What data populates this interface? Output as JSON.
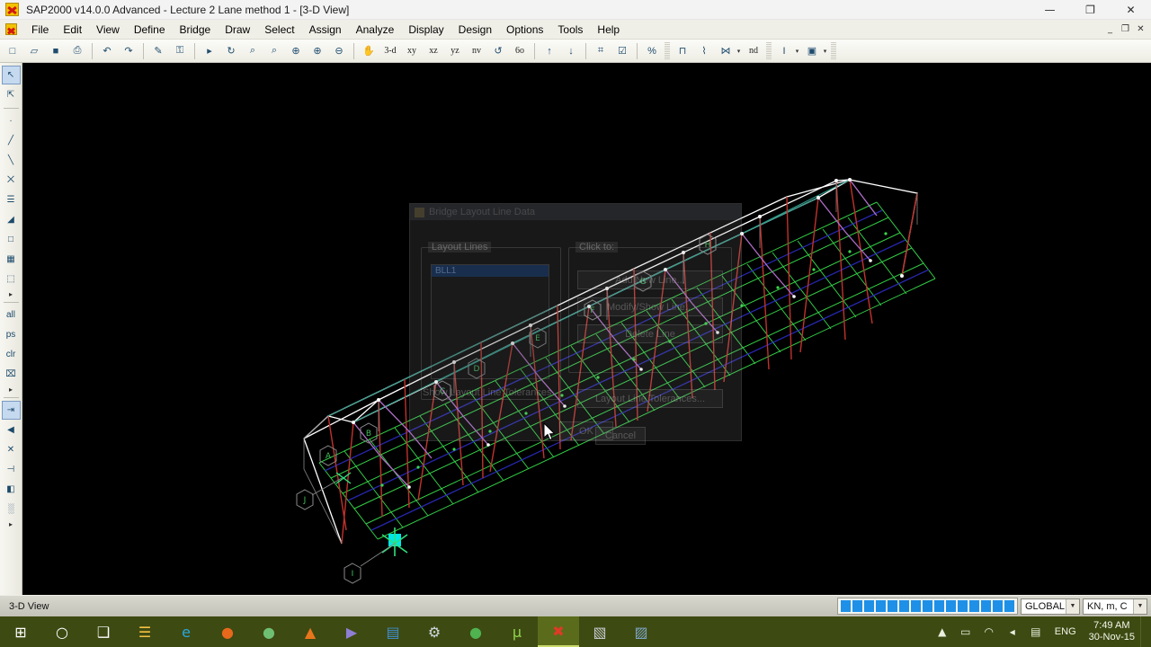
{
  "window": {
    "title": "SAP2000 v14.0.0 Advanced  - Lecture 2 Lane method 1 - [3-D View]",
    "app_icon": "sap2000-icon",
    "minimize": "—",
    "maximize": "❐",
    "close": "✕"
  },
  "mdi": {
    "minimize": "_",
    "restore": "❐",
    "close": "✕"
  },
  "menu": {
    "items": [
      {
        "label": "File"
      },
      {
        "label": "Edit"
      },
      {
        "label": "View"
      },
      {
        "label": "Define"
      },
      {
        "label": "Bridge"
      },
      {
        "label": "Draw"
      },
      {
        "label": "Select"
      },
      {
        "label": "Assign"
      },
      {
        "label": "Analyze"
      },
      {
        "label": "Display"
      },
      {
        "label": "Design"
      },
      {
        "label": "Options"
      },
      {
        "label": "Tools"
      },
      {
        "label": "Help"
      }
    ]
  },
  "toolbar": {
    "items": [
      {
        "name": "new-file-icon",
        "glyph": "□",
        "type": "icon"
      },
      {
        "name": "open-file-icon",
        "glyph": "▱",
        "type": "icon"
      },
      {
        "name": "save-icon",
        "glyph": "■",
        "type": "icon"
      },
      {
        "name": "print-icon",
        "glyph": "⎙",
        "type": "icon"
      },
      {
        "name": "sep1",
        "glyph": "",
        "type": "sep"
      },
      {
        "name": "undo-icon",
        "glyph": "↶",
        "type": "icon"
      },
      {
        "name": "redo-icon",
        "glyph": "↷",
        "type": "icon"
      },
      {
        "name": "sep2",
        "glyph": "",
        "type": "sep"
      },
      {
        "name": "refresh-window-icon",
        "glyph": "✎",
        "type": "icon"
      },
      {
        "name": "lock-unlock-model-icon",
        "glyph": "⚿",
        "type": "icon"
      },
      {
        "name": "sep3",
        "glyph": "",
        "type": "sep"
      },
      {
        "name": "run-analysis-icon",
        "glyph": "▸",
        "type": "icon"
      },
      {
        "name": "rubber-band-zoom-icon",
        "glyph": "↻",
        "type": "icon"
      },
      {
        "name": "restore-full-view-icon",
        "glyph": "⌕",
        "type": "icon"
      },
      {
        "name": "previous-zoom-icon",
        "glyph": "⌕",
        "type": "icon"
      },
      {
        "name": "zoom-in-one-step-icon",
        "glyph": "⊕",
        "type": "icon"
      },
      {
        "name": "zoom-in-icon",
        "glyph": "⊕",
        "type": "icon"
      },
      {
        "name": "zoom-out-icon",
        "glyph": "⊖",
        "type": "icon"
      },
      {
        "name": "sep4",
        "glyph": "",
        "type": "sep"
      },
      {
        "name": "pan-icon",
        "glyph": "✋",
        "type": "icon"
      },
      {
        "name": "view-3d-label",
        "glyph": "3-d",
        "type": "text"
      },
      {
        "name": "view-xy-label",
        "glyph": "xy",
        "type": "text"
      },
      {
        "name": "view-xz-label",
        "glyph": "xz",
        "type": "text"
      },
      {
        "name": "view-yz-label",
        "glyph": "yz",
        "type": "text"
      },
      {
        "name": "view-nv-label",
        "glyph": "nv",
        "type": "text"
      },
      {
        "name": "rotate-3d-view-icon",
        "glyph": "↺",
        "type": "icon"
      },
      {
        "name": "perspective-toggle-label",
        "glyph": "6o",
        "type": "text"
      },
      {
        "name": "sep5",
        "glyph": "",
        "type": "sep"
      },
      {
        "name": "move-up-in-list-icon",
        "glyph": "↑",
        "type": "icon"
      },
      {
        "name": "move-down-in-list-icon",
        "glyph": "↓",
        "type": "icon"
      },
      {
        "name": "sep6",
        "glyph": "",
        "type": "sep"
      },
      {
        "name": "set-display-options-icon",
        "glyph": "⌗",
        "type": "icon"
      },
      {
        "name": "set-select-mode-icon",
        "glyph": "☑",
        "type": "icon"
      },
      {
        "name": "sep7",
        "glyph": "",
        "type": "sep"
      },
      {
        "name": "scale-percent-icon",
        "glyph": "%",
        "type": "icon"
      },
      {
        "name": "grip1",
        "glyph": "",
        "type": "grip"
      },
      {
        "name": "draw-frame-icon",
        "glyph": "⊓",
        "type": "icon"
      },
      {
        "name": "draw-secondary-icon",
        "glyph": "⌇",
        "type": "icon"
      },
      {
        "name": "draw-section-cut-icon",
        "glyph": "⋈",
        "type": "icon"
      },
      {
        "name": "drop-section",
        "glyph": "▾",
        "type": "drop"
      },
      {
        "name": "no-design-label",
        "glyph": "nd",
        "type": "text"
      },
      {
        "name": "grip2",
        "glyph": "",
        "type": "grip"
      },
      {
        "name": "text-tool-icon",
        "glyph": "I",
        "type": "icon"
      },
      {
        "name": "drop-text",
        "glyph": "▾",
        "type": "drop"
      },
      {
        "name": "snap-picture-icon",
        "glyph": "▣",
        "type": "icon"
      },
      {
        "name": "drop-picture",
        "glyph": "▾",
        "type": "drop"
      },
      {
        "name": "grip3",
        "glyph": "",
        "type": "grip"
      }
    ]
  },
  "left_toolbar": {
    "items": [
      {
        "name": "pointer-select-icon",
        "glyph": "↖",
        "selected": true
      },
      {
        "name": "reshape-element-icon",
        "glyph": "⇱",
        "selected": false
      },
      {
        "name": "sep-a",
        "glyph": "",
        "type": "sep"
      },
      {
        "name": "draw-point-icon",
        "glyph": "·",
        "selected": false
      },
      {
        "name": "draw-frame-cable-icon",
        "glyph": "╱",
        "selected": false
      },
      {
        "name": "quick-draw-frame-icon",
        "glyph": "╲",
        "selected": false
      },
      {
        "name": "quick-draw-brace-icon",
        "glyph": "⨉",
        "selected": false
      },
      {
        "name": "quick-draw-secondary-icon",
        "glyph": "☰",
        "selected": false
      },
      {
        "name": "draw-poly-area-icon",
        "glyph": "◢",
        "selected": false
      },
      {
        "name": "draw-rectangular-area-icon",
        "glyph": "□",
        "selected": false
      },
      {
        "name": "quick-draw-area-icon",
        "glyph": "▦",
        "selected": false
      },
      {
        "name": "draw-solid-icon",
        "glyph": "⬚",
        "selected": false
      },
      {
        "name": "draw-more-icon",
        "glyph": "▸",
        "type": "more"
      },
      {
        "name": "sep-b",
        "glyph": "",
        "type": "sep"
      },
      {
        "name": "select-all-icon",
        "glyph": "all",
        "selected": false
      },
      {
        "name": "select-previous-icon",
        "glyph": "ps",
        "selected": false
      },
      {
        "name": "clear-selection-icon",
        "glyph": "clr",
        "selected": false
      },
      {
        "name": "deselect-icon",
        "glyph": "⌧",
        "selected": false
      },
      {
        "name": "select-more-icon",
        "glyph": "▸",
        "type": "more"
      },
      {
        "name": "sep-c",
        "glyph": "",
        "type": "sep"
      },
      {
        "name": "set-intersecting-line-icon",
        "glyph": "⇥",
        "selected": true
      },
      {
        "name": "select-using-poly-icon",
        "glyph": "◀",
        "selected": false
      },
      {
        "name": "select-crossing-line-icon",
        "glyph": "✕",
        "selected": false
      },
      {
        "name": "select-xy-plane-icon",
        "glyph": "⊣",
        "selected": false
      },
      {
        "name": "select-xz-plane-icon",
        "glyph": "◧",
        "selected": false
      },
      {
        "name": "select-area-icon",
        "glyph": "░",
        "selected": false
      },
      {
        "name": "select-extra-more-icon",
        "glyph": "▸",
        "type": "more"
      }
    ]
  },
  "dialog": {
    "title": "Bridge Layout Line Data",
    "icon": "dialog-icon",
    "groups": {
      "layout_lines": {
        "label": "Layout Lines"
      },
      "click_to": {
        "label": "Click to:"
      }
    },
    "list": {
      "selected_item": "BLL1"
    },
    "buttons": {
      "add_new": "Add New Line...",
      "modify": "Modify/Show Line...",
      "delete": "Delete Line",
      "show_start_bearings": "Show Layout Line Tolerances",
      "tolerances": "Layout Line Tolerances...",
      "ok": "OK",
      "cancel": "Cancel"
    }
  },
  "status_bar": {
    "view_label": "3-D View",
    "progress_blocks": 15,
    "coord_system": "GLOBAL",
    "units": "KN, m, C",
    "dropdown_glyph": "▼"
  },
  "taskbar": {
    "items": [
      {
        "name": "start-button",
        "glyph": "⊞",
        "color": "#ffffff",
        "active": false
      },
      {
        "name": "cortana-search-icon",
        "glyph": "○",
        "color": "#ffffff",
        "active": false
      },
      {
        "name": "task-view-icon",
        "glyph": "❑",
        "color": "#ffffff",
        "active": false
      },
      {
        "name": "file-explorer-icon",
        "glyph": "☰",
        "color": "#f5c242",
        "active": false
      },
      {
        "name": "internet-explorer-icon",
        "glyph": "e",
        "color": "#29a8e0",
        "active": false
      },
      {
        "name": "firefox-icon",
        "glyph": "●",
        "color": "#e8681c",
        "active": false
      },
      {
        "name": "browser-globe-icon",
        "glyph": "●",
        "color": "#6fbf73",
        "active": false
      },
      {
        "name": "vlc-player-icon",
        "glyph": "▲",
        "color": "#e8761c",
        "active": false
      },
      {
        "name": "media-player-icon",
        "glyph": "▶",
        "color": "#8f7fd4",
        "active": false
      },
      {
        "name": "notes-app-icon",
        "glyph": "▤",
        "color": "#3f8fd0",
        "active": false
      },
      {
        "name": "settings-app-icon",
        "glyph": "⚙",
        "color": "#cfd8df",
        "active": false
      },
      {
        "name": "chrome-icon",
        "glyph": "●",
        "color": "#4fb34f",
        "active": false
      },
      {
        "name": "utorrent-icon",
        "glyph": "µ",
        "color": "#8fd44f",
        "active": false
      },
      {
        "name": "sap2000-taskbar-icon",
        "glyph": "✖",
        "color": "#e03a26",
        "active": true
      },
      {
        "name": "pdf-reader-icon",
        "glyph": "▧",
        "color": "#c8ccd4",
        "active": false
      },
      {
        "name": "photos-app-icon",
        "glyph": "▨",
        "color": "#7fa8c9",
        "active": false
      }
    ],
    "tray": {
      "show_hidden_icon": "▲",
      "battery_icon": "▭",
      "network_icon": "◠",
      "volume_icon": "◂",
      "action_center_icon": "▤",
      "language": "ENG",
      "time": "7:49 AM",
      "date": "30-Nov-15"
    }
  },
  "model": {
    "view_name": "3-D View",
    "grid_labels": [
      "A",
      "B",
      "C",
      "D",
      "E",
      "F",
      "J",
      "I"
    ],
    "colors": {
      "background": "#000000",
      "deck_grid": "#36d94a",
      "truss_top": "#ffffff",
      "truss_diagonal": "#c0322c",
      "truss_vertical": "#b06ec9",
      "truss_teal": "#2f9c8c",
      "support": "#00e5e5",
      "bubble_outline": "#8a8a8a",
      "lane_line": "#2b2bbf"
    }
  }
}
